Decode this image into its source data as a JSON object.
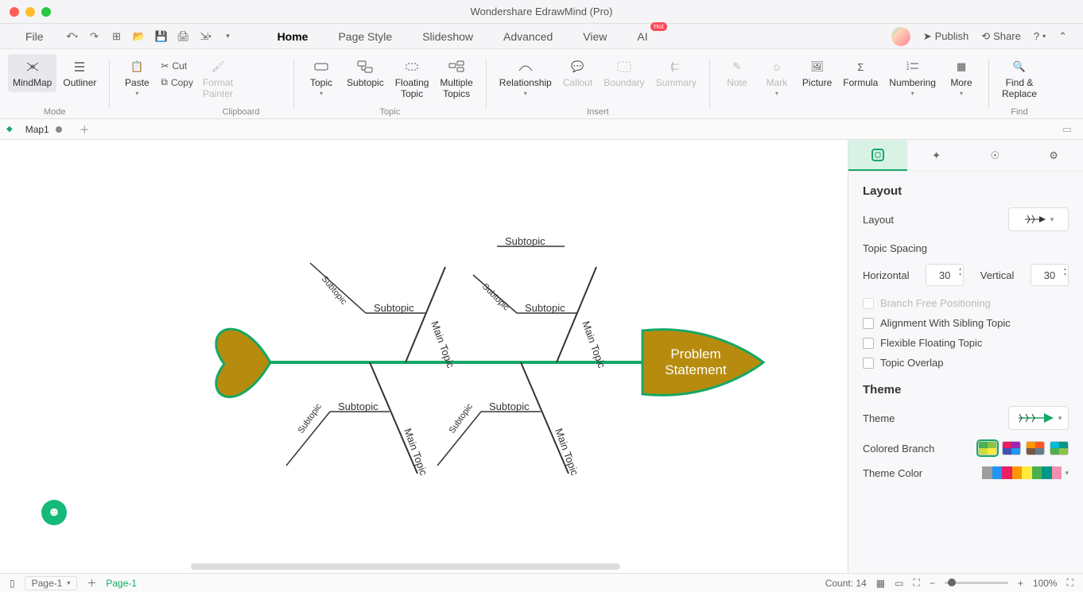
{
  "window": {
    "title": "Wondershare EdrawMind (Pro)"
  },
  "menu": {
    "file": "File",
    "tabs": [
      "Home",
      "Page Style",
      "Slideshow",
      "Advanced",
      "View",
      "AI"
    ],
    "active_tab": "Home",
    "hot_badge": "Hot",
    "publish": "Publish",
    "share": "Share"
  },
  "ribbon": {
    "mode": {
      "label": "Mode",
      "mindmap": "MindMap",
      "outliner": "Outliner"
    },
    "clipboard": {
      "label": "Clipboard",
      "paste": "Paste",
      "cut": "Cut",
      "copy": "Copy",
      "format_painter": "Format\nPainter"
    },
    "topic": {
      "label": "Topic",
      "topic": "Topic",
      "subtopic": "Subtopic",
      "floating": "Floating\nTopic",
      "multiple": "Multiple\nTopics"
    },
    "insert": {
      "label": "Insert",
      "relationship": "Relationship",
      "callout": "Callout",
      "boundary": "Boundary",
      "summary": "Summary",
      "note": "Note",
      "mark": "Mark",
      "picture": "Picture",
      "formula": "Formula",
      "numbering": "Numbering",
      "more": "More"
    },
    "find": {
      "label": "Find",
      "findreplace": "Find &\nReplace"
    }
  },
  "doc_tabs": {
    "name": "Map1"
  },
  "fishbone": {
    "head": "Problem\nStatement",
    "main_topic": "Main Topic",
    "subtopic": "Subtopic"
  },
  "side": {
    "layout_h": "Layout",
    "layout_label": "Layout",
    "topic_spacing": "Topic Spacing",
    "horizontal": "Horizontal",
    "vertical": "Vertical",
    "h_val": "30",
    "v_val": "30",
    "branch_free": "Branch Free Positioning",
    "align_sibling": "Alignment With Sibling Topic",
    "flex_float": "Flexible Floating Topic",
    "overlap": "Topic Overlap",
    "theme_h": "Theme",
    "theme_label": "Theme",
    "colored_branch": "Colored Branch",
    "theme_color": "Theme Color"
  },
  "status": {
    "page_sel": "Page-1",
    "page_active": "Page-1",
    "count": "Count: 14",
    "zoom": "100%"
  },
  "colors": {
    "fish_body": "#b78b0e",
    "fish_outline": "#15a866",
    "bone": "#333333"
  }
}
